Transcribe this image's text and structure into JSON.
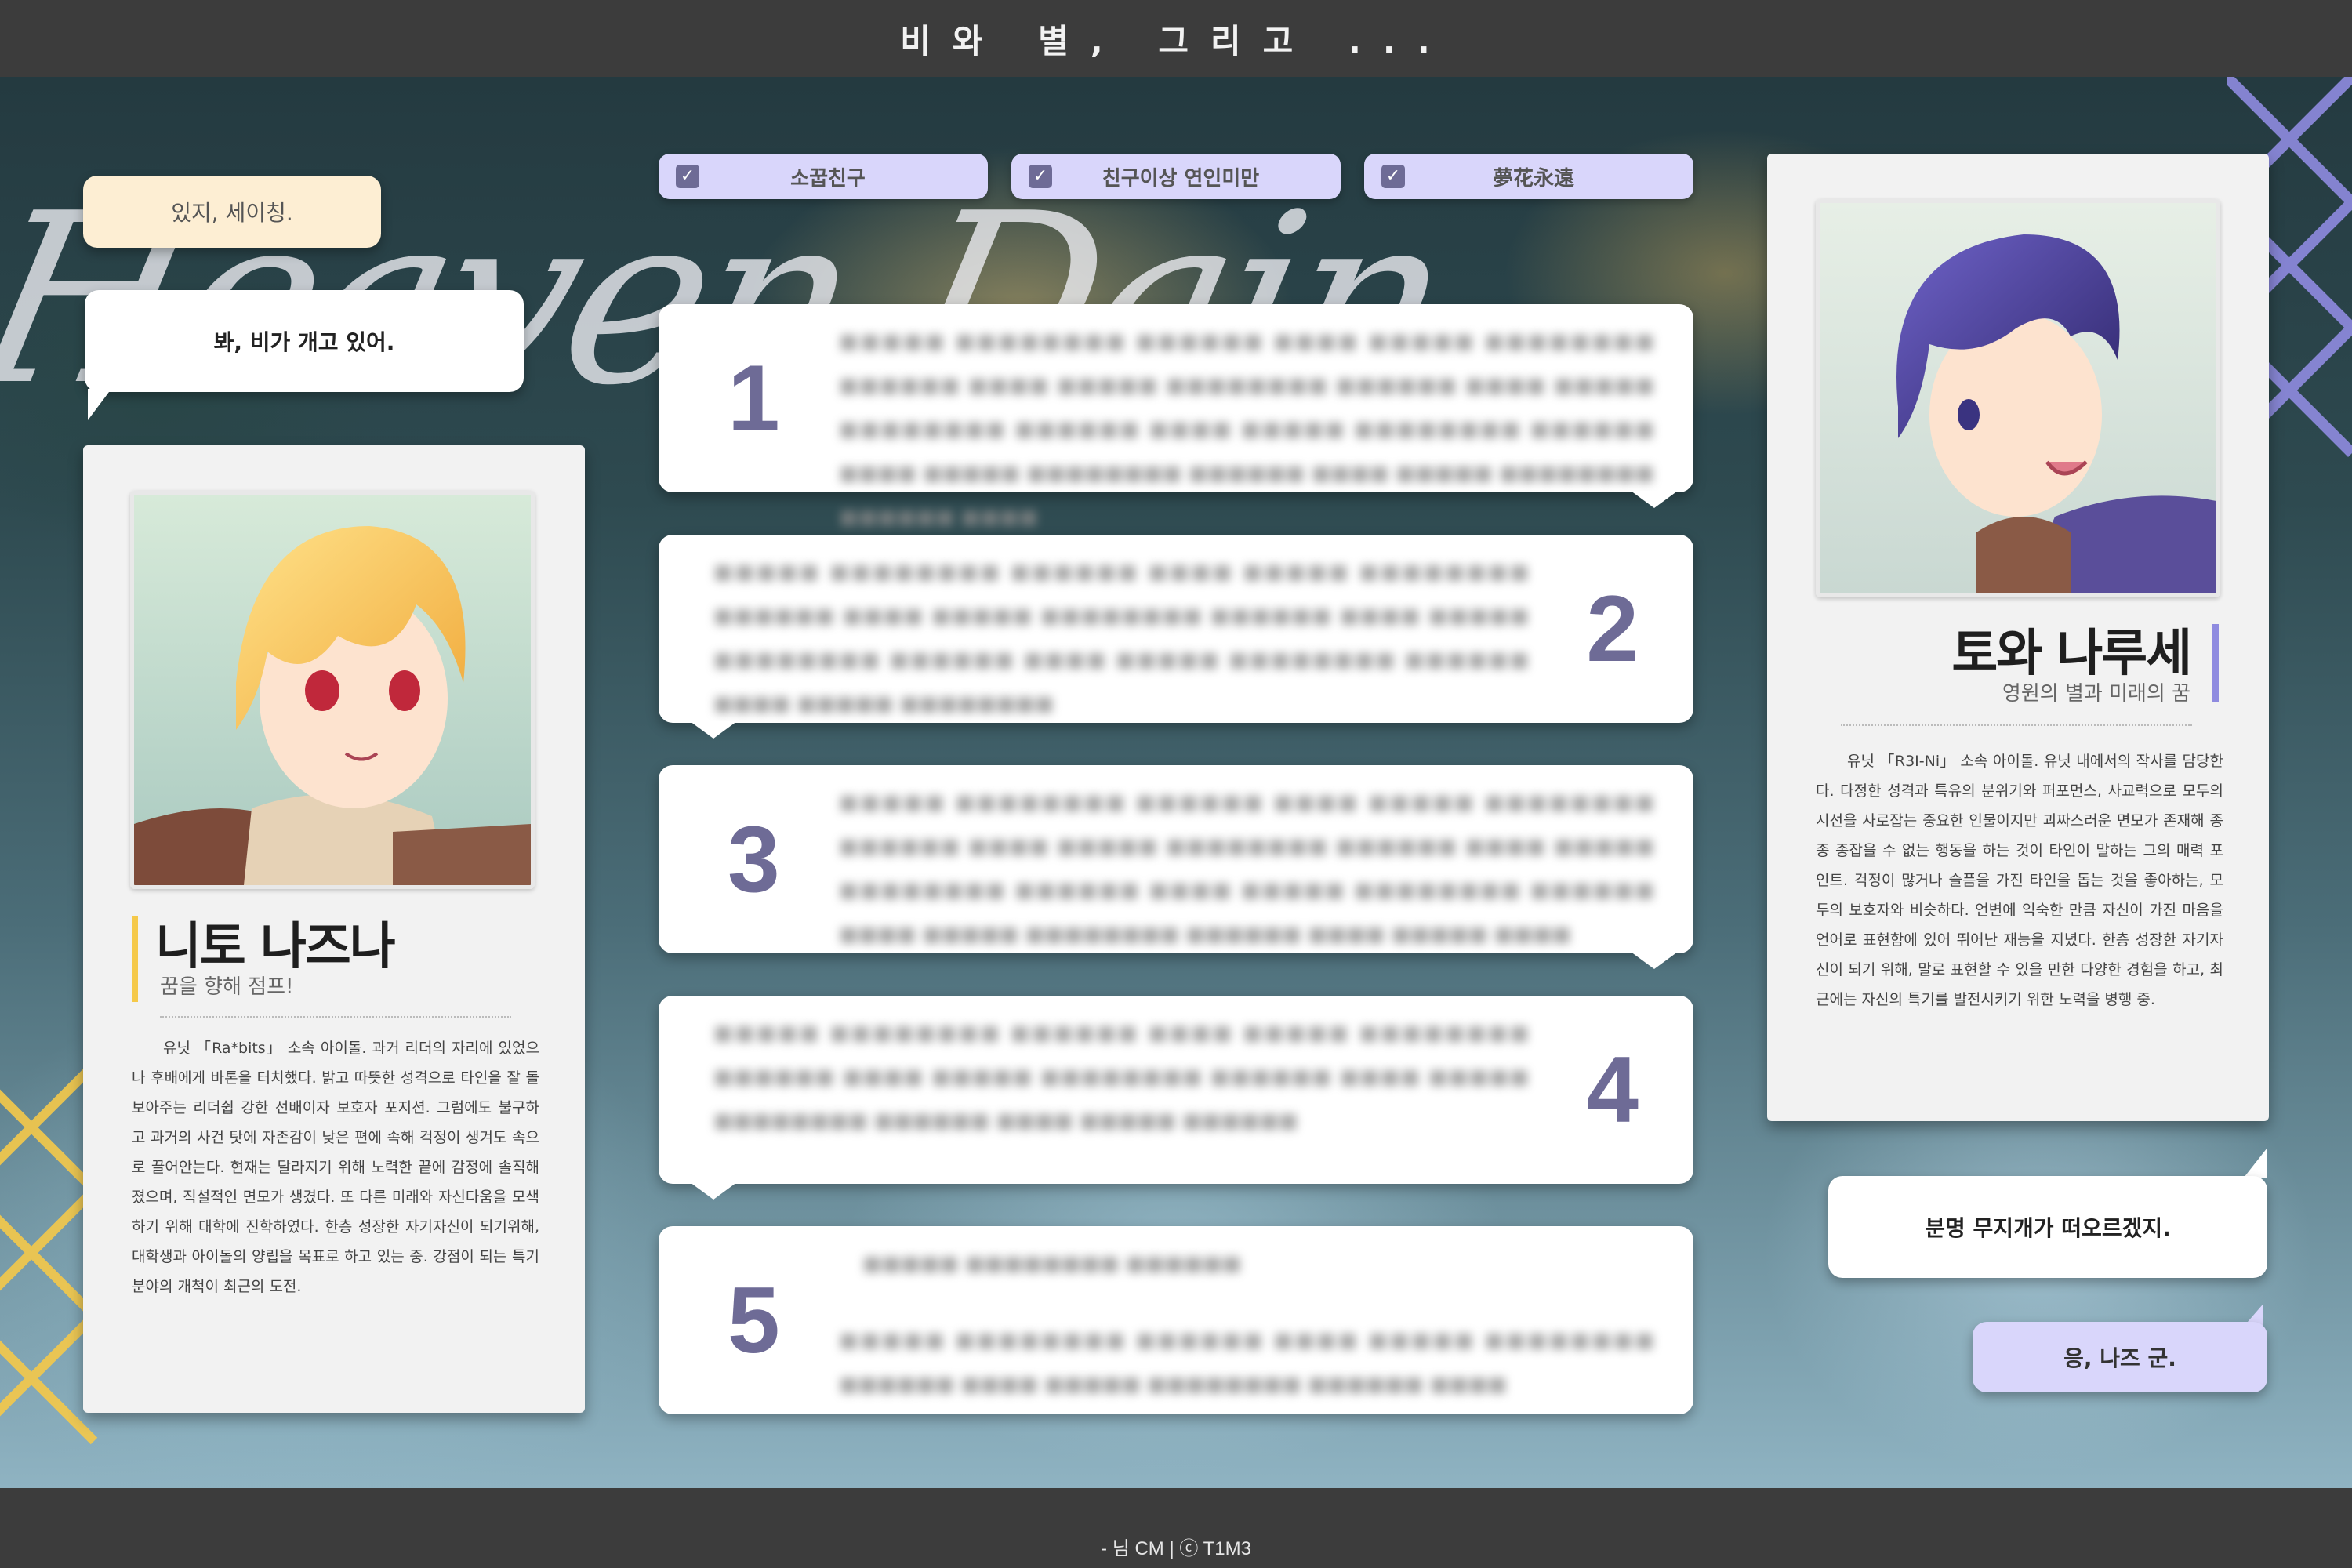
{
  "header": {
    "title": "비와 별, 그리고 ..."
  },
  "footer": {
    "credit": "- 님 CM | ⓒ T1M3"
  },
  "tags": [
    {
      "label": "소꿉친구",
      "checked": true
    },
    {
      "label": "친구이상 연인미만",
      "checked": true
    },
    {
      "label": "夢花永遠",
      "checked": true
    }
  ],
  "bubbles": {
    "left_top": "있지, 세이칭.",
    "left_main": "봐, 비가 개고 있어.",
    "right_main": "분명 무지개가 떠오르겠지.",
    "right_bottom": "응, 나즈 군."
  },
  "left_char": {
    "name": "니토 나즈나",
    "subtitle": "꿈을 향해 점프!",
    "accent_color": "#f5c94a",
    "description": "유닛 「Ra*bits」 소속 아이돌. 과거 리더의 자리에 있었으나 후배에게 바톤을 터치했다. 밝고 따뜻한 성격으로 타인을 잘 돌보아주는 리더쉽 강한 선배이자 보호자 포지션. 그럼에도 불구하고 과거의 사건 탓에 자존감이 낮은 편에 속해 걱정이 생겨도 속으로 끌어안는다. 현재는 달라지기 위해 노력한 끝에 감정에 솔직해졌으며, 직설적인 면모가 생겼다. 또 다른 미래와 자신다움을 모색하기 위해 대학에 진학하였다. 한층 성장한 자기자신이 되기위해, 대학생과 아이돌의 양립을 목표로 하고 있는 중. 강점이 되는 특기 분야의 개척이 최근의 도전."
  },
  "right_char": {
    "name": "토와 나루세",
    "subtitle": "영원의 별과 미래의 꿈",
    "accent_color": "#8f8be0",
    "description": "유닛 「R3I-Ni」 소속 아이돌. 유닛 내에서의 작사를 담당한다. 다정한 성격과 특유의 분위기와 퍼포먼스, 사교력으로 모두의 시선을 사로잡는 중요한 인물이지만 괴짜스러운 면모가 존재해 종종 종잡을 수 없는 행동을 하는 것이 타인이 말하는 그의 매력 포인트. 걱정이 많거나 슬픔을 가진 타인을 돕는 것을 좋아하는, 모두의 보호자와 비슷하다. 언변에 익숙한 만큼 자신이 가진 마음을 언어로 표현함에 있어 뛰어난 재능을 지녔다. 한층 성장한 자기자신이 되기 위해, 말로 표현할 수 있을 만한 다양한 경험을 하고, 최근에는 자신의 특기를 발전시키기 위한 노력을 병행 중."
  },
  "panels": [
    {
      "number": "1"
    },
    {
      "number": "2"
    },
    {
      "number": "3"
    },
    {
      "number": "4"
    },
    {
      "number": "5"
    }
  ],
  "colors": {
    "accent_purple": "#6e6b96",
    "tag_lavender": "#d9d6fb",
    "bubble_cream": "#fdeed3"
  }
}
